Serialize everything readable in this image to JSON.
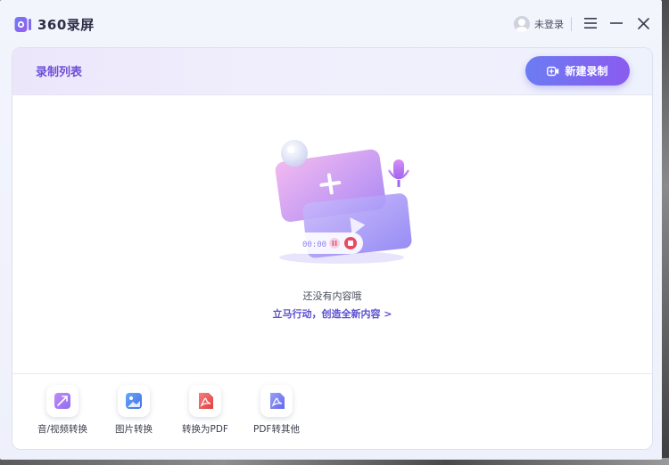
{
  "app": {
    "logo_text": "360录屏",
    "user_label": "未登录"
  },
  "recording_list": {
    "title": "录制列表",
    "new_button_label": "新建录制"
  },
  "empty_state": {
    "message": "还没有内容哦",
    "cta": "立马行动，创造全新内容 >",
    "timer": "00:00"
  },
  "tools": [
    {
      "label": "音/视频转换",
      "icon": "media-convert-icon",
      "color": "#a17cf3"
    },
    {
      "label": "图片转换",
      "icon": "image-convert-icon",
      "color": "#4f8df5"
    },
    {
      "label": "转换为PDF",
      "icon": "to-pdf-icon",
      "color": "#f05a5a"
    },
    {
      "label": "PDF转其他",
      "icon": "pdf-convert-icon",
      "color": "#7b84f3"
    }
  ],
  "colors": {
    "accent": "#6d4fd8",
    "button_gradient_start": "#6b7cf2",
    "button_gradient_end": "#8b5bf0"
  }
}
